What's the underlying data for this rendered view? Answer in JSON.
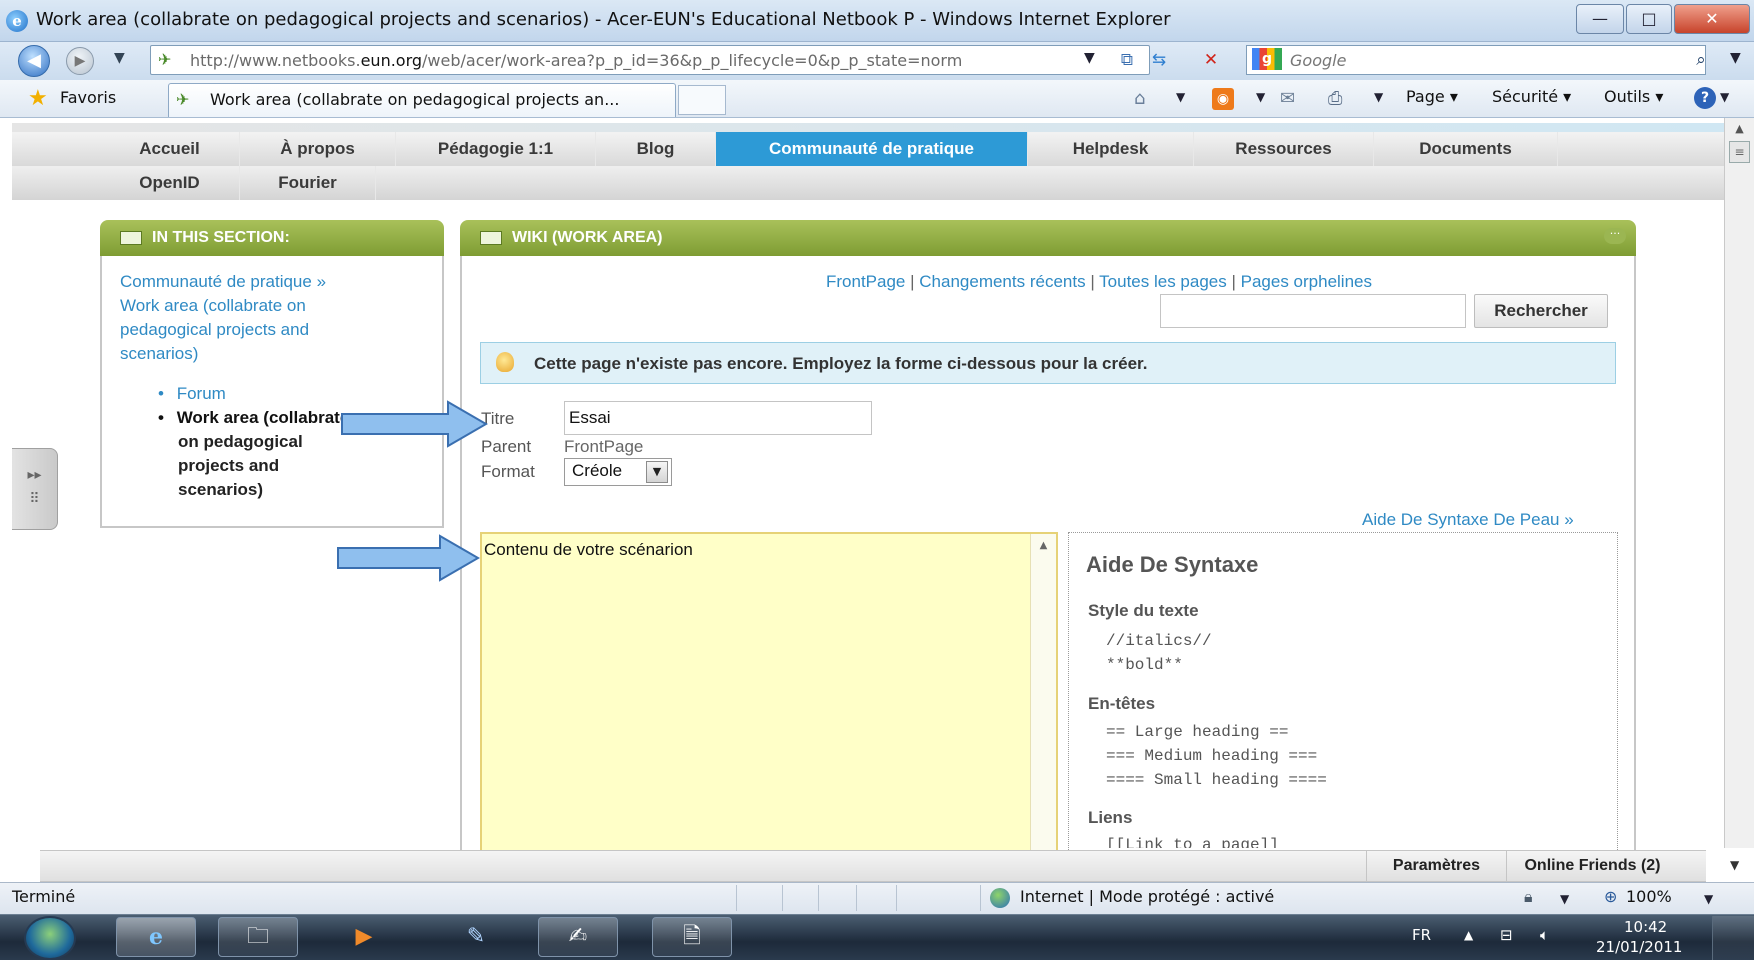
{
  "window": {
    "title": "Work area (collabrate on pedagogical projects and scenarios) - Acer-EUN's Educational Netbook P - Windows Internet Explorer",
    "buttons": {
      "minimize": "—",
      "maximize": "□",
      "close": "✕"
    }
  },
  "browser": {
    "address_prefix": "http://www.netbooks.",
    "address_domain": "eun.org",
    "address_suffix": "/web/acer/work-area?p_p_id=36&p_p_lifecycle=0&p_p_state=norm",
    "search_placeholder": "Google",
    "favorites_label": "Favoris",
    "tab_label": "Work area (collabrate on pedagogical projects an...",
    "commands": {
      "page": "Page ▾",
      "security": "Sécurité ▾",
      "tools": "Outils ▾"
    }
  },
  "site_nav": {
    "row1": [
      "Accueil",
      "À propos",
      "Pédagogie 1:1",
      "Blog",
      "Communauté de pratique",
      "Helpdesk",
      "Ressources",
      "Documents"
    ],
    "row2": [
      "OpenID",
      "Fourier"
    ],
    "active": "Communauté de pratique"
  },
  "left_portlet": {
    "header": "IN THIS SECTION:",
    "breadcrumb_parent": "Communauté de pratique",
    "breadcrumb_sep": "»",
    "breadcrumb_lines": [
      "Work area (collabrate on",
      "pedagogical projects and",
      "scenarios)"
    ],
    "items": [
      {
        "label_lines": [
          "Forum"
        ],
        "active": false
      },
      {
        "label_lines": [
          "Work area (collabrate",
          "on pedagogical",
          "projects and",
          "scenarios)"
        ],
        "active": true
      }
    ]
  },
  "wiki": {
    "header": "WIKI (WORK AREA)",
    "links": [
      "FrontPage",
      "Changements récents",
      "Toutes les pages",
      "Pages orphelines"
    ],
    "link_sep": " | ",
    "search_button": "Rechercher",
    "search_value": "",
    "info_message": "Cette page n'existe pas encore. Employez la forme ci-dessous pour la créer.",
    "form": {
      "title_label": "Titre",
      "title_value": "Essai",
      "parent_label": "Parent",
      "parent_value": "FrontPage",
      "format_label": "Format",
      "format_value": "Créole"
    },
    "help_link": "Aide De Syntaxe De Peau »",
    "editor_text": "Contenu de votre scénarion",
    "syntax": {
      "title": "Aide De Syntaxe",
      "sections": [
        {
          "heading": "Style du texte",
          "lines": [
            "//italics//",
            "**bold**"
          ]
        },
        {
          "heading": "En-têtes",
          "lines": [
            "== Large heading ==",
            "=== Medium heading ===",
            "==== Small heading ===="
          ]
        },
        {
          "heading": "Liens",
          "lines": [
            "[[Link to a page]]"
          ]
        }
      ]
    }
  },
  "social_bar": {
    "settings": "Paramètres",
    "friends": "Online Friends (2)"
  },
  "status": {
    "left": "Terminé",
    "zone": "Internet | Mode protégé : activé",
    "zoom": "100%"
  },
  "taskbar": {
    "lang": "FR",
    "time": "10:42",
    "date": "21/01/2011"
  },
  "colors": {
    "nav_active": "#2d9ad6",
    "portlet_header": "#8aa83e",
    "link": "#2f8ac4",
    "annotation_arrow": "#8fbfee"
  }
}
